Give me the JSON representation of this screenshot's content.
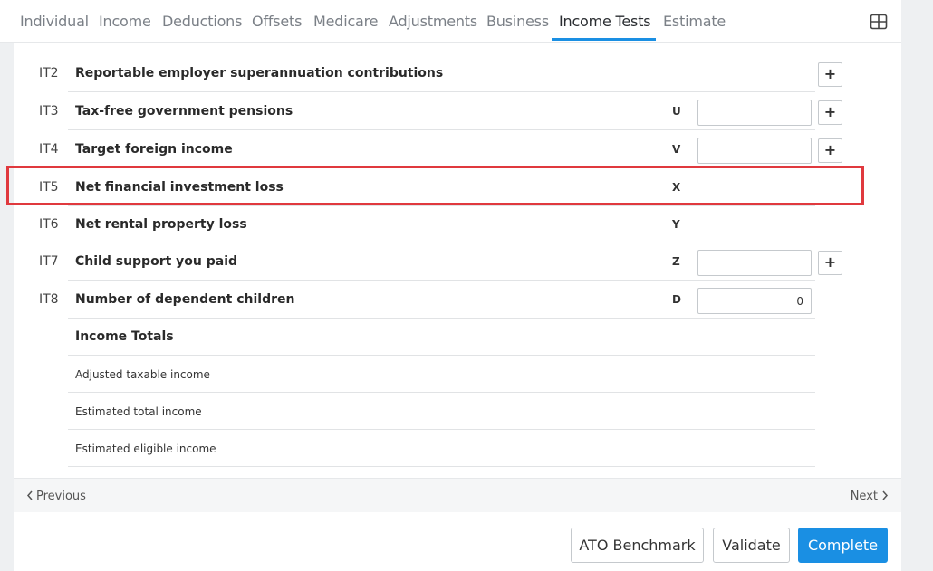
{
  "tabs": [
    {
      "label": "Individual"
    },
    {
      "label": "Income"
    },
    {
      "label": "Deductions"
    },
    {
      "label": "Offsets"
    },
    {
      "label": "Medicare"
    },
    {
      "label": "Adjustments"
    },
    {
      "label": "Business"
    },
    {
      "label": "Income Tests",
      "active": true
    },
    {
      "label": "Estimate"
    }
  ],
  "icons": {
    "layout": "grid-layout-icon",
    "add": "plus-icon",
    "prev": "chevron-left-icon",
    "next": "chevron-right-icon"
  },
  "rows": [
    {
      "code": "IT2",
      "label": "Reportable employer superannuation contributions",
      "letter": "",
      "value": ""
    },
    {
      "code": "IT3",
      "label": "Tax-free government pensions",
      "letter": "U",
      "value": ""
    },
    {
      "code": "IT4",
      "label": "Target foreign income",
      "letter": "V",
      "value": ""
    },
    {
      "code": "IT5",
      "label": "Net financial investment loss",
      "letter": "X",
      "value": ""
    },
    {
      "code": "IT6",
      "label": "Net rental property loss",
      "letter": "Y",
      "value": ""
    },
    {
      "code": "IT7",
      "label": "Child support you paid",
      "letter": "Z",
      "value": ""
    },
    {
      "code": "IT8",
      "label": "Number of dependent children",
      "letter": "D",
      "value": "0"
    }
  ],
  "totals": {
    "heading": "Income Totals",
    "items": [
      "Adjusted taxable income",
      "Estimated total income",
      "Estimated eligible income"
    ]
  },
  "plus_symbol": "+",
  "navigation": {
    "previous": "Previous",
    "next": "Next"
  },
  "actions": {
    "benchmark": "ATO Benchmark",
    "validate": "Validate",
    "complete": "Complete"
  },
  "colors": {
    "accent": "#1a8fe3",
    "highlight": "#e0393e"
  }
}
